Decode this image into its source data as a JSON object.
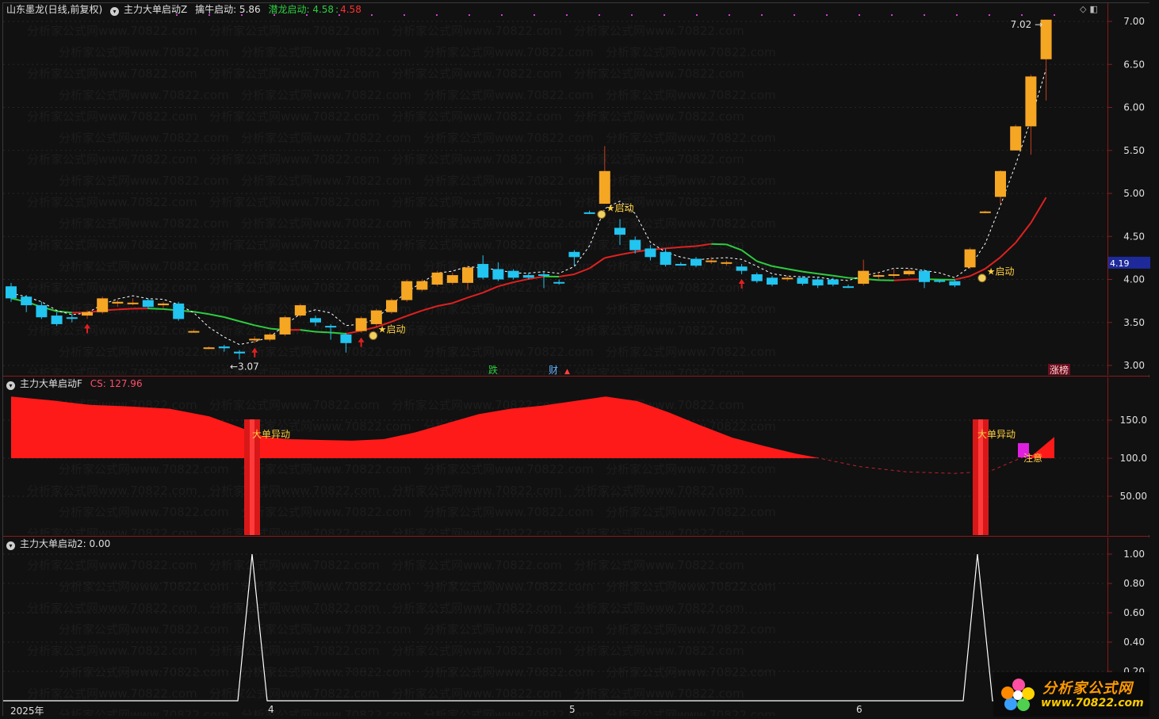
{
  "header1": {
    "stock": "山东墨龙(日线,前复权)",
    "indicator": "主力大单启动Z",
    "qn_label": "擒牛启动: 5.86",
    "ql_label": "潜龙启动: 4.58",
    "ql_value": "4.58"
  },
  "header2": {
    "name": "主力大单启动F",
    "cs_label": "CS: 127.96"
  },
  "header3": {
    "name": "主力大单启动2",
    "value": ": 0.00"
  },
  "price_axis": {
    "ticks": [
      "7.00",
      "6.50",
      "6.00",
      "5.50",
      "5.00",
      "4.50",
      "4.00",
      "3.50",
      "3.00"
    ],
    "current": "4.19"
  },
  "f_axis": {
    "ticks": [
      "150.0",
      "100.0",
      "50.00"
    ]
  },
  "s_axis": {
    "ticks": [
      "1.00",
      "0.80",
      "0.60",
      "0.40",
      "0.20"
    ]
  },
  "dates": [
    "2025年",
    "4",
    "5",
    "6"
  ],
  "annotations": {
    "low": "←3.07",
    "high": "7.02",
    "start": "★启动",
    "big_order": "大单异动",
    "attention": "注意",
    "tag_die": "跌",
    "tag_cai": "财",
    "tag_zhangbang": "涨榜"
  },
  "colors": {
    "up": "#f5a623",
    "down": "#22c4f0",
    "ma_up": "#e02020",
    "ma_down": "#2ecc40",
    "area": "#ff1a1a"
  },
  "watermark": "分析家公式网www.70822.com",
  "logo": {
    "title": "分析家公式网",
    "url": "www.70822.com"
  },
  "chart_data": {
    "type": "candlestick",
    "ylim": [
      2.9,
      7.1
    ],
    "candles": [
      [
        3.92,
        3.78,
        3.96,
        3.74
      ],
      [
        3.8,
        3.7,
        3.82,
        3.62
      ],
      [
        3.7,
        3.56,
        3.74,
        3.54
      ],
      [
        3.58,
        3.48,
        3.62,
        3.46
      ],
      [
        3.56,
        3.55,
        3.6,
        3.5
      ],
      [
        3.58,
        3.62,
        3.64,
        3.54
      ],
      [
        3.62,
        3.78,
        3.8,
        3.6
      ],
      [
        3.72,
        3.74,
        3.76,
        3.68
      ],
      [
        3.72,
        3.73,
        3.78,
        3.7
      ],
      [
        3.76,
        3.68,
        3.78,
        3.66
      ],
      [
        3.7,
        3.72,
        3.74,
        3.66
      ],
      [
        3.72,
        3.54,
        3.74,
        3.52
      ],
      [
        3.4,
        3.4,
        3.42,
        3.38
      ],
      [
        3.2,
        3.21,
        3.22,
        3.19
      ],
      [
        3.22,
        3.2,
        3.24,
        3.16
      ],
      [
        3.16,
        3.14,
        3.18,
        3.07
      ],
      [
        3.3,
        3.31,
        3.34,
        3.26
      ],
      [
        3.3,
        3.36,
        3.38,
        3.28
      ],
      [
        3.36,
        3.56,
        3.58,
        3.34
      ],
      [
        3.58,
        3.7,
        3.72,
        3.56
      ],
      [
        3.55,
        3.5,
        3.58,
        3.46
      ],
      [
        3.46,
        3.45,
        3.48,
        3.3
      ],
      [
        3.36,
        3.26,
        3.38,
        3.15
      ],
      [
        3.4,
        3.55,
        3.57,
        3.38
      ],
      [
        3.48,
        3.64,
        3.66,
        3.44
      ],
      [
        3.62,
        3.76,
        3.78,
        3.6
      ],
      [
        3.76,
        3.98,
        4.0,
        3.74
      ],
      [
        3.88,
        3.98,
        4.0,
        3.86
      ],
      [
        3.94,
        4.08,
        4.1,
        3.92
      ],
      [
        3.96,
        4.05,
        4.08,
        3.94
      ],
      [
        3.96,
        4.14,
        4.16,
        3.88
      ],
      [
        4.18,
        4.02,
        4.28,
        4.0
      ],
      [
        4.12,
        4.0,
        4.2,
        3.98
      ],
      [
        4.1,
        4.02,
        4.12,
        4.0
      ],
      [
        4.05,
        4.02,
        4.08,
        4.0
      ],
      [
        4.06,
        4.05,
        4.1,
        3.9
      ],
      [
        3.97,
        3.96,
        4.0,
        3.94
      ],
      [
        4.32,
        4.26,
        4.34,
        4.16
      ],
      [
        4.78,
        4.77,
        4.8,
        4.76
      ],
      [
        4.88,
        5.26,
        5.55,
        4.88
      ],
      [
        4.6,
        4.52,
        4.7,
        4.4
      ],
      [
        4.46,
        4.34,
        4.5,
        4.3
      ],
      [
        4.36,
        4.26,
        4.4,
        4.22
      ],
      [
        4.32,
        4.17,
        4.36,
        4.15
      ],
      [
        4.18,
        4.17,
        4.2,
        4.16
      ],
      [
        4.24,
        4.16,
        4.26,
        4.14
      ],
      [
        4.22,
        4.22,
        4.26,
        4.18
      ],
      [
        4.2,
        4.2,
        4.22,
        4.16
      ],
      [
        4.15,
        4.1,
        4.18,
        4.06
      ],
      [
        4.06,
        3.98,
        4.08,
        3.96
      ],
      [
        4.02,
        3.94,
        4.04,
        3.92
      ],
      [
        4.02,
        4.02,
        4.04,
        3.98
      ],
      [
        4.02,
        3.95,
        4.04,
        3.93
      ],
      [
        4.0,
        3.93,
        4.02,
        3.9
      ],
      [
        4.0,
        3.94,
        4.02,
        3.92
      ],
      [
        3.92,
        3.91,
        3.94,
        3.9
      ],
      [
        3.95,
        4.1,
        4.23,
        3.93
      ],
      [
        4.04,
        4.05,
        4.08,
        4.0
      ],
      [
        4.06,
        4.06,
        4.12,
        4.02
      ],
      [
        4.06,
        4.1,
        4.12,
        4.04
      ],
      [
        4.1,
        3.97,
        4.12,
        3.9
      ],
      [
        3.99,
        3.98,
        4.0,
        3.96
      ],
      [
        3.98,
        3.93,
        4.0,
        3.91
      ],
      [
        4.14,
        4.35,
        4.37,
        4.12
      ],
      [
        4.78,
        4.79,
        4.8,
        4.77
      ],
      [
        4.96,
        5.26,
        5.27,
        4.88
      ],
      [
        5.5,
        5.78,
        5.8,
        5.5
      ],
      [
        5.78,
        6.36,
        6.38,
        5.45
      ],
      [
        6.56,
        7.02,
        7.02,
        6.08
      ]
    ],
    "x_dates": [
      "2025年",
      "4",
      "5",
      "6"
    ]
  }
}
